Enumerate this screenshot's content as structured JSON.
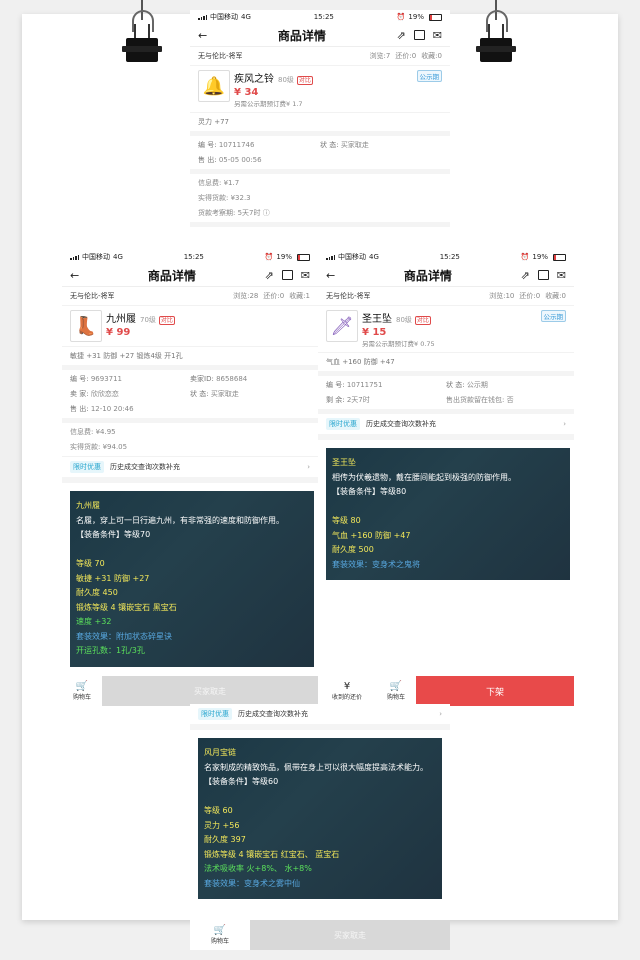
{
  "status": {
    "carrier": "中国移动",
    "network": "4G",
    "time": "15:25",
    "battery": "19%"
  },
  "nav": {
    "title": "商品详情",
    "back": "←",
    "share": "⇗",
    "folder": "",
    "mail": "✉"
  },
  "common": {
    "cart_label": "购物车",
    "buyer_took": "买家取走",
    "promo_tag": "限时优惠",
    "promo_text": "历史成交查询次数补充",
    "arrow": "›",
    "public_badge": "公示期",
    "compare_badge": "对比"
  },
  "screen1": {
    "seller": "无与伦比-将军",
    "browse": "浏览:7",
    "bargain": "还价:0",
    "fav": "收藏:0",
    "item_name": "疾风之铃",
    "level": "80级",
    "price": "¥ 34",
    "fee_note": "另需公示期预订费¥ 1.7",
    "attrs": "灵力 +77",
    "id_label": "编 号:",
    "id": "10711746",
    "state_label": "状 态:",
    "state": "买家取走",
    "sold_label": "售 出:",
    "sold": "05-05 00:56",
    "info_fee": "信息费: ¥1.7",
    "actual": "实得货款: ¥32.3",
    "period": "货款考察期: 5天7时"
  },
  "screen2": {
    "seller": "无与伦比-将军",
    "browse": "浏览:28",
    "bargain": "还价:0",
    "fav": "收藏:1",
    "item_name": "九州履",
    "level": "70级",
    "price": "¥ 99",
    "attrs": "敏捷 +31 防御 +27 锻炼4级 开1孔",
    "id_label": "编 号:",
    "id": "9693711",
    "seller_id_label": "卖家ID:",
    "seller_id": "8658684",
    "seller_label": "卖 家:",
    "seller_name": "欣欣恋恋",
    "state_label": "状 态:",
    "state": "买家取走",
    "sold_label": "售 出:",
    "sold": "12-10 20:46",
    "info_fee": "信息费: ¥4.95",
    "actual": "实得货款: ¥94.05",
    "card": {
      "name": "九州履",
      "desc": "名履，穿上可一日行遍九州，有非常强的速度和防御作用。",
      "req": "【装备条件】等级70",
      "level": "等级 70",
      "stats": "敏捷 +31 防御 +27",
      "durability": "耐久度 450",
      "forge": "锻炼等级 4 镶嵌宝石 黑宝石",
      "speed": "速度 +32",
      "set": "套装效果：附加状态碎星诀",
      "holes": "开运孔数：1孔/3孔"
    }
  },
  "screen3": {
    "seller": "无与伦比-将军",
    "browse": "浏览:10",
    "bargain": "还价:0",
    "fav": "收藏:0",
    "item_name": "圣王坠",
    "level": "80级",
    "price": "¥ 15",
    "fee_note": "另需公示期预订费¥ 0.75",
    "attrs": "气血 +160 防御 +47",
    "id_label": "编 号:",
    "id": "10711751",
    "state_label": "状 态:",
    "state": "公示期",
    "remain_label": "剩 余:",
    "remain": "2天7时",
    "sold_goods": "售出货款留在钱包: 否",
    "card": {
      "name": "圣王坠",
      "desc": "相传为伏羲遗物，戴在腰间能起到极强的防御作用。",
      "req": "【装备条件】等级80",
      "level": "等级 80",
      "stats": "气血 +160 防御 +47",
      "durability": "耐久度 500",
      "set": "套装效果：变身术之鬼将"
    },
    "received_bargain": "收到的还价",
    "delist": "下架"
  },
  "screen4": {
    "card": {
      "name": "风月宝链",
      "desc": "名家制成的精致饰品，佩带在身上可以很大幅度提高法术能力。",
      "req": "【装备条件】等级60",
      "level": "等级 60",
      "stats": "灵力 +56",
      "durability": "耐久度 397",
      "forge": "锻炼等级 4 镶嵌宝石 红宝石、 蓝宝石",
      "spell": "法术吸收率 火+8%、 水+8%",
      "set": "套装效果：变身术之雾中仙"
    }
  }
}
